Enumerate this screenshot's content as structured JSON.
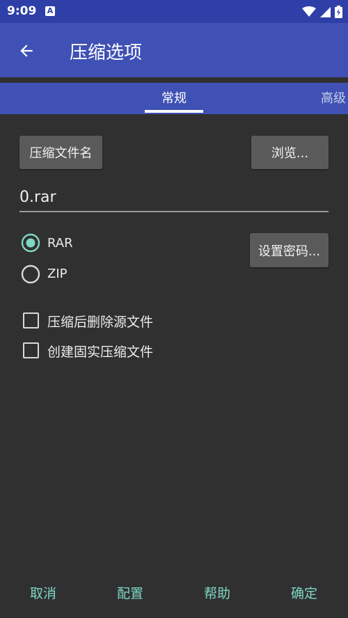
{
  "status_bar": {
    "time": "9:09",
    "notification_icon": "A",
    "icons": [
      "wifi-icon",
      "signal-icon",
      "battery-icon"
    ]
  },
  "app_bar": {
    "title": "压缩选项",
    "back_icon": "arrow-left-icon"
  },
  "tabs": [
    {
      "label": "常规",
      "selected": true
    },
    {
      "label": "高级",
      "selected": false
    }
  ],
  "general": {
    "archive_name_button": "压缩文件名",
    "browse_button": "浏览...",
    "archive_name_value": "0.rar",
    "format_options": [
      {
        "label": "RAR",
        "selected": true
      },
      {
        "label": "ZIP",
        "selected": false
      }
    ],
    "set_password_button": "设置密码...",
    "checkboxes": [
      {
        "label": "压缩后删除源文件",
        "checked": false
      },
      {
        "label": "创建固实压缩文件",
        "checked": false
      }
    ]
  },
  "footer": {
    "cancel": "取消",
    "config": "配置",
    "help": "帮助",
    "ok": "确定"
  },
  "colors": {
    "app_bar": "#3f51b5",
    "status_bar": "#2f3fa8",
    "background": "#303030",
    "accent": "#7fd7c4"
  }
}
